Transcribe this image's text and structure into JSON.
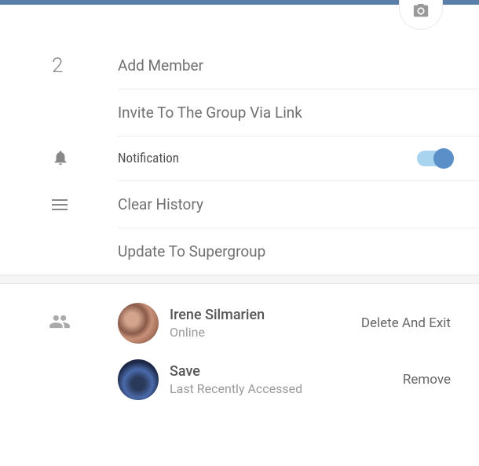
{
  "header": {
    "member_count": "2",
    "add_member_label": "Add Member"
  },
  "actions": {
    "invite_link_label": "Invite To The Group Via Link",
    "notification_label": "Notification",
    "notification_on": true,
    "clear_history_label": "Clear History",
    "update_supergroup_label": "Update To Supergroup"
  },
  "members": [
    {
      "name": "Irene Silmarien",
      "status": "Online",
      "action": "Delete And Exit"
    },
    {
      "name": "Save",
      "status": "Last Recently Accessed",
      "action": "Remove"
    }
  ]
}
